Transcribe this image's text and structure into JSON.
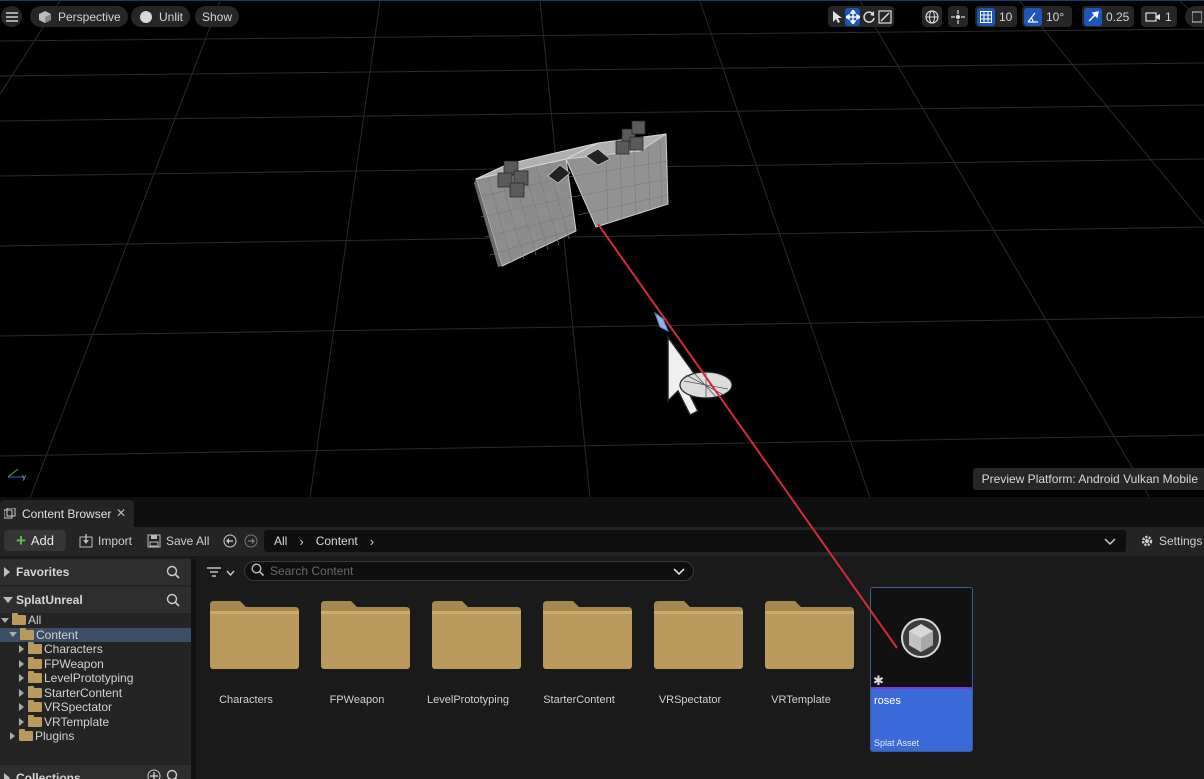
{
  "viewport": {
    "toolbar": {
      "menu_icon": "hamburger-icon",
      "perspective_label": "Perspective",
      "lit_mode_label": "Unlit",
      "show_label": "Show",
      "grid_snap_value": "10",
      "rotation_snap_value": "10°",
      "scale_snap_value": "0.25",
      "camera_speed_value": "1"
    },
    "preview_platform": "Preview Platform:  Android Vulkan Mobile"
  },
  "content_browser": {
    "tab_title": "Content Browser",
    "toolbar": {
      "add_label": "Add",
      "import_label": "Import",
      "save_all_label": "Save All",
      "settings_label": "Settings"
    },
    "path": [
      "All",
      "Content"
    ],
    "sidebar": {
      "favorites_label": "Favorites",
      "project_label": "SplatUnreal",
      "tree": [
        {
          "label": "All",
          "level": 0,
          "open": true
        },
        {
          "label": "Content",
          "level": 1,
          "open": true,
          "selected": true
        },
        {
          "label": "Characters",
          "level": 2
        },
        {
          "label": "FPWeapon",
          "level": 2
        },
        {
          "label": "LevelPrototyping",
          "level": 2
        },
        {
          "label": "StarterContent",
          "level": 2
        },
        {
          "label": "VRSpectator",
          "level": 2
        },
        {
          "label": "VRTemplate",
          "level": 2
        },
        {
          "label": "Plugins",
          "level": 1
        }
      ],
      "collections_label": "Collections"
    },
    "search_placeholder": "Search Content",
    "folders": [
      "Characters",
      "FPWeapon",
      "LevelPrototyping",
      "StarterContent",
      "VRSpectator",
      "VRTemplate"
    ],
    "asset": {
      "name": "roses",
      "type": "Splat Asset"
    }
  },
  "colors": {
    "accent_blue": "#1c56b8",
    "asset_blue": "#3a6ad8",
    "folder_tan": "#b99a5c",
    "drag_line_red": "#d42a3c"
  }
}
